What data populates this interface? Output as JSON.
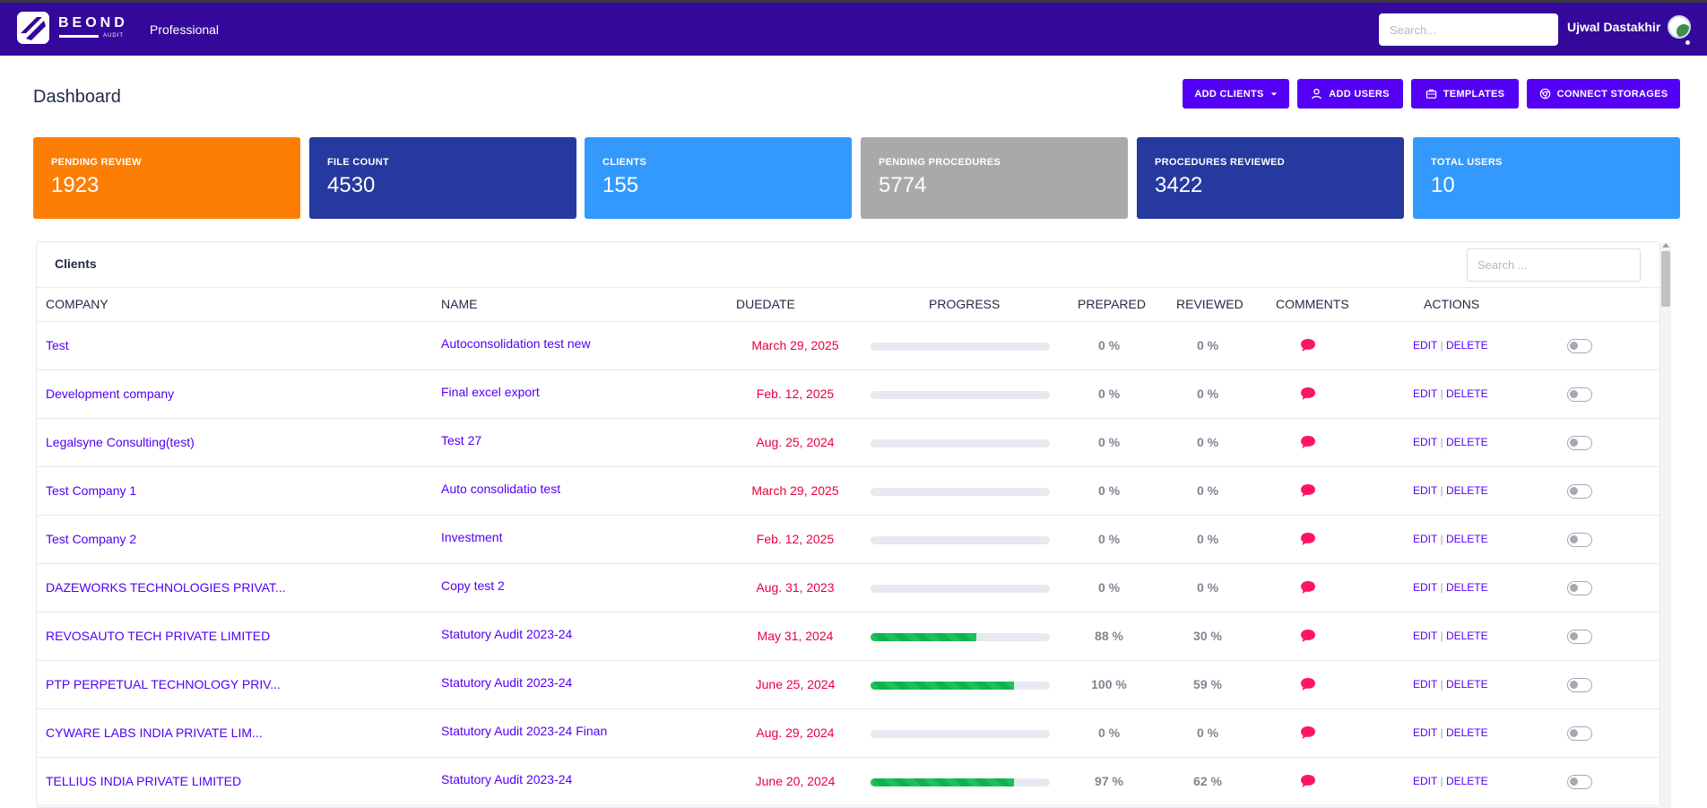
{
  "header": {
    "plan": "Professional",
    "search_placeholder": "Search...",
    "username": "Ujwal Dastakhir",
    "logo_text": "BEOND",
    "logo_sub": "AUDIT"
  },
  "page": {
    "title": "Dashboard"
  },
  "buttons": {
    "add_clients": "ADD CLIENTS",
    "add_users": "ADD USERS",
    "templates": "TEMPLATES",
    "connect_storages": "CONNECT STORAGES"
  },
  "cards": [
    {
      "label": "PENDING REVIEW",
      "value": "1923",
      "color": "#fd7e05"
    },
    {
      "label": "FILE COUNT",
      "value": "4530",
      "color": "#25399f"
    },
    {
      "label": "CLIENTS",
      "value": "155",
      "color": "#3399fc"
    },
    {
      "label": "PENDING PROCEDURES",
      "value": "5774",
      "color": "#a9a9a9"
    },
    {
      "label": "PROCEDURES REVIEWED",
      "value": "3422",
      "color": "#25399f"
    },
    {
      "label": "TOTAL USERS",
      "value": "10",
      "color": "#3399fc"
    }
  ],
  "clients": {
    "title": "Clients",
    "search_placeholder": "Search ...",
    "columns": [
      "COMPANY",
      "NAME",
      "DUEDATE",
      "PROGRESS",
      "PREPARED",
      "REVIEWED",
      "COMMENTS",
      "ACTIONS"
    ],
    "edit_label": "EDIT",
    "sep": "|",
    "delete_label": "DELETE",
    "rows": [
      {
        "company": "Test",
        "name": "Autoconsolidation test new",
        "due": "March 29, 2025",
        "progress": 0,
        "prepared": "0 %",
        "reviewed": "0 %"
      },
      {
        "company": "Development company",
        "name": "Final excel export",
        "due": "Feb. 12, 2025",
        "progress": 0,
        "prepared": "0 %",
        "reviewed": "0 %"
      },
      {
        "company": "Legalsyne Consulting(test)",
        "name": "Test 27",
        "due": "Aug. 25, 2024",
        "progress": 0,
        "prepared": "0 %",
        "reviewed": "0 %"
      },
      {
        "company": "Test Company 1",
        "name": "Auto consolidatio test",
        "due": "March 29, 2025",
        "progress": 0,
        "prepared": "0 %",
        "reviewed": "0 %"
      },
      {
        "company": "Test Company 2",
        "name": "Investment",
        "due": "Feb. 12, 2025",
        "progress": 0,
        "prepared": "0 %",
        "reviewed": "0 %"
      },
      {
        "company": "DAZEWORKS TECHNOLOGIES PRIVAT...",
        "name": "Copy test 2",
        "due": "Aug. 31, 2023",
        "progress": 0,
        "prepared": "0 %",
        "reviewed": "0 %"
      },
      {
        "company": "REVOSAUTO TECH PRIVATE LIMITED",
        "name": "Statutory Audit 2023-24",
        "due": "May 31, 2024",
        "progress": 59,
        "prepared": "88 %",
        "reviewed": "30 %"
      },
      {
        "company": "PTP PERPETUAL TECHNOLOGY PRIV...",
        "name": "Statutory Audit 2023-24",
        "due": "June 25, 2024",
        "progress": 80,
        "prepared": "100 %",
        "reviewed": "59 %"
      },
      {
        "company": "CYWARE LABS INDIA PRIVATE LIM...",
        "name": "Statutory Audit 2023-24 Finan",
        "due": "Aug. 29, 2024",
        "progress": 0,
        "prepared": "0 %",
        "reviewed": "0 %"
      },
      {
        "company": "TELLIUS INDIA PRIVATE LIMITED",
        "name": "Statutory Audit 2023-24",
        "due": "June 20, 2024",
        "progress": 80,
        "prepared": "97 %",
        "reviewed": "62 %"
      }
    ]
  },
  "colors": {
    "nav": "#33089a",
    "accent": "#5400f5",
    "due": "#e8003d",
    "comment": "#ff1464",
    "progress": "#19c35a"
  },
  "icons": {
    "logo": "logo-icon",
    "avatar": "avatar-icon",
    "add_clients_caret": "caret-down-icon",
    "add_users": "user-icon",
    "templates": "briefcase-icon",
    "connect_storages": "chrome-icon",
    "comment": "comment-icon",
    "toggle": "toggle-switch"
  }
}
